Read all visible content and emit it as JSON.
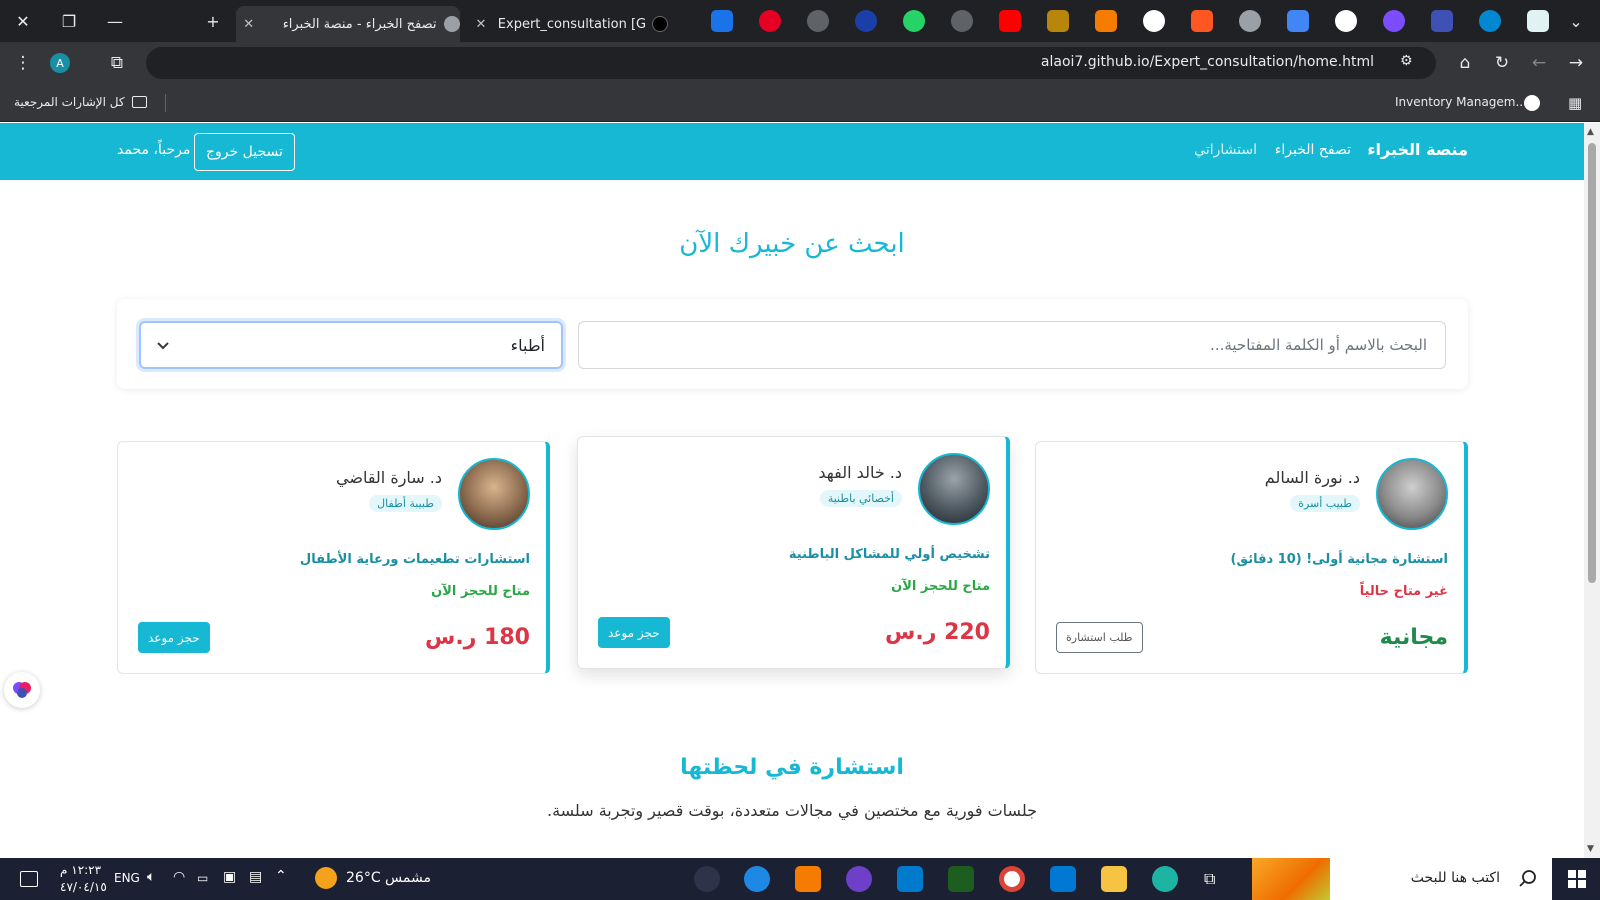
{
  "browser": {
    "tabs": [
      {
        "title": "تصفح الخبراء - منصة الخبراء",
        "active": true
      },
      {
        "title": "Expert_consultation [GitHub]",
        "active": false
      }
    ],
    "address": "alaoi7.github.io/Expert_consultation/home.html",
    "bookmarks": {
      "all_bookmarks": "كل الإشارات المرجعية",
      "inventory": "Inventory Managem..."
    },
    "avatar_letter": "A"
  },
  "nav": {
    "brand": "منصة الخبراء",
    "browse_experts": "تصفح الخبراء",
    "my_consultations": "استشاراتي",
    "logout": "تسجيل خروج",
    "greeting": "مرحباً، محمد"
  },
  "search": {
    "title": "ابحث عن خبيرك الآن",
    "placeholder": "البحث بالاسم أو الكلمة المفتاحية...",
    "category_selected": "أطباء"
  },
  "experts": [
    {
      "name": "د. نورة السالم",
      "specialty": "طبيب أسرة",
      "service": "استشارة مجانية أولى! (10 دقائق)",
      "availability": "غير متاح حالياً",
      "available": false,
      "price": "مجانية",
      "action": "طلب استشارة"
    },
    {
      "name": "د. خالد الفهد",
      "specialty": "أخصائي باطنية",
      "service": "تشخيص أولي للمشاكل الباطنية",
      "availability": "متاح للحجز الآن",
      "available": true,
      "price": "220 ر.س",
      "action": "حجز موعد"
    },
    {
      "name": "د. سارة القاضي",
      "specialty": "طبيبة أطفال",
      "service": "استشارات تطعيمات ورعاية الأطفال",
      "availability": "متاح للحجز الآن",
      "available": true,
      "price": "180 ر.س",
      "action": "حجز موعد"
    }
  ],
  "instant": {
    "title": "استشارة في لحظتها",
    "subtitle": "جلسات فورية مع مختصين في مجالات متعددة، بوقت قصير وتجربة سلسة."
  },
  "taskbar": {
    "search_placeholder": "اكتب هنا للبحث",
    "weather": "26°C  مشمس",
    "language": "ENG",
    "time": "١٢:٢٣ م",
    "date": "٤٧/٠٤/١٥"
  },
  "colors": {
    "primary": "#17b8d3",
    "price_red": "#dc3545",
    "available_green": "#28a745",
    "free_green": "#1e8a4c"
  }
}
